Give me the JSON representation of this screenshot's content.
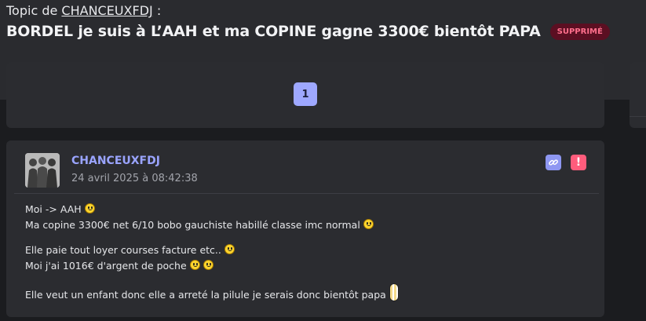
{
  "topic": {
    "prefix": "Topic de",
    "author_link": "CHANCEUXFDJ",
    "suffix": ":",
    "title": "BORDEL je suis à L’AAH et ma COPINE gagne 3300€ bientôt PAPA",
    "status_badge": "SUPPRIMÉ"
  },
  "pagination": {
    "current_page": "1"
  },
  "post": {
    "author": "CHANCEUXFDJ",
    "date": "24 avril 2025 à 08:42:38",
    "actions": [
      "link-icon",
      "alert-icon"
    ],
    "report_glyph": "!",
    "lines": {
      "l1": "Moi -> AAH",
      "l2": "Ma copine 3300€ net 6/10 bobo gauchiste habillé classe imc normal",
      "l3": "Elle paie tout loyer courses facture etc..",
      "l4": "Moi j'ai 1016€ d'argent de poche",
      "l5": "Elle veut un enfant donc elle a arreté la pilule je serais donc bientôt papa"
    }
  },
  "colors": {
    "accent": "#9aa4ff",
    "badge_bg": "#5b0f22",
    "badge_text": "#ff6f8c",
    "report": "#ff5c7c"
  }
}
